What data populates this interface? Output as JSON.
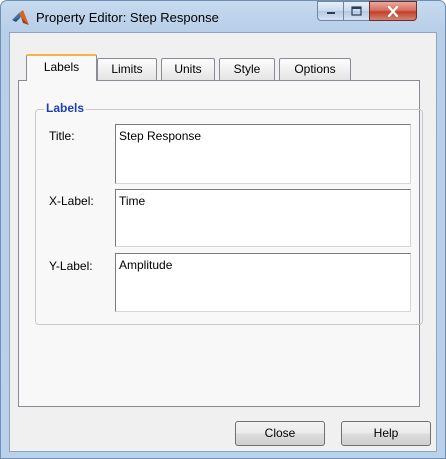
{
  "window": {
    "title": "Property Editor: Step Response",
    "icon": "matlab-icon",
    "controls": {
      "minimize": "minimize-icon",
      "maximize": "maximize-icon",
      "close": "close-icon"
    }
  },
  "tabs": [
    {
      "label": "Labels",
      "active": true
    },
    {
      "label": "Limits",
      "active": false
    },
    {
      "label": "Units",
      "active": false
    },
    {
      "label": "Style",
      "active": false
    },
    {
      "label": "Options",
      "active": false
    }
  ],
  "labels_group": {
    "title": "Labels",
    "fields": [
      {
        "label": "Title:",
        "value": "Step Response"
      },
      {
        "label": "X-Label:",
        "value": "Time"
      },
      {
        "label": "Y-Label:",
        "value": "Amplitude"
      }
    ]
  },
  "buttons": {
    "close": "Close",
    "help": "Help"
  },
  "colors": {
    "group_title": "#1f3fb6",
    "active_tab_accent": "#f3b44a",
    "close_button": "#c2402c"
  }
}
